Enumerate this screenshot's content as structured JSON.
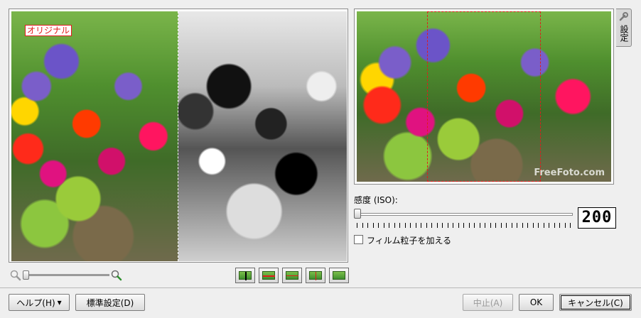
{
  "preview": {
    "original_label": "オリジナル",
    "watermark": "FreeFoto.com"
  },
  "side_tab": {
    "label": "設定",
    "icon": "wrench-icon"
  },
  "sensitivity": {
    "label": "感度 (ISO):",
    "value": "200",
    "slider_fraction": 0.0
  },
  "film_grain": {
    "label": "フィルム粒子を加える",
    "checked": false
  },
  "zoom": {
    "min_icon": "zoom-out-icon",
    "max_icon": "zoom-in-icon",
    "slider_fraction": 0.0
  },
  "compare_modes": [
    {
      "name": "compare-mode-original-icon"
    },
    {
      "name": "compare-mode-split-vertical-icon"
    },
    {
      "name": "compare-mode-split-horizontal-icon"
    },
    {
      "name": "compare-mode-split-duplicate-icon"
    },
    {
      "name": "compare-mode-preview-icon"
    }
  ],
  "buttons": {
    "help": "ヘルプ(H)",
    "defaults": "標準設定(D)",
    "abort": "中止(A)",
    "ok": "OK",
    "cancel": "キャンセル(C)"
  },
  "colors": {
    "guide_red": "#e21b1b"
  }
}
